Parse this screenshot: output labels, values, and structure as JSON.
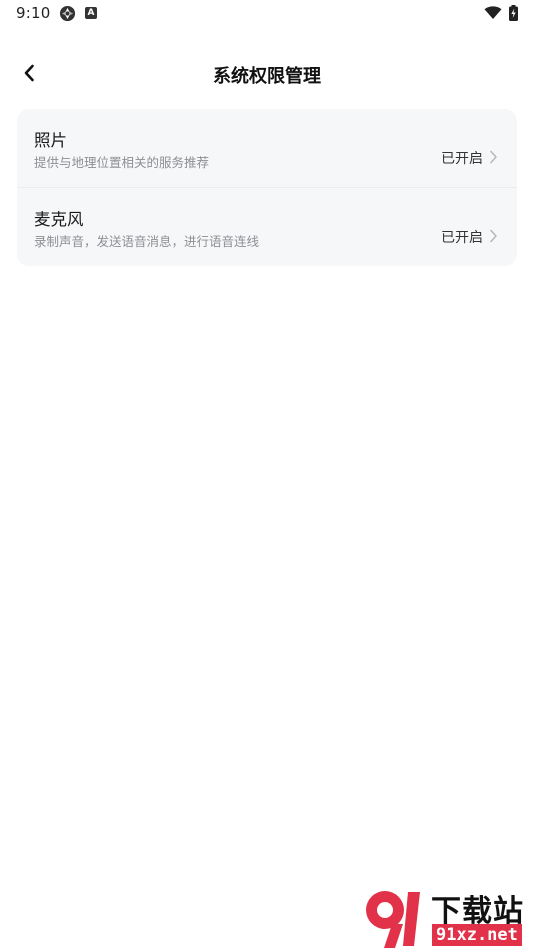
{
  "status_bar": {
    "time": "9:10",
    "icons": [
      "aperture-icon",
      "a-badge-icon",
      "wifi-icon",
      "battery-charging-icon"
    ],
    "badge_letter": "A"
  },
  "header": {
    "title": "系统权限管理",
    "back_icon": "chevron-left-icon"
  },
  "permissions": [
    {
      "title": "照片",
      "description": "提供与地理位置相关的服务推荐",
      "status": "已开启",
      "icon": "chevron-right-icon"
    },
    {
      "title": "麦克风",
      "description": "录制声音，发送语音消息，进行语音连线",
      "status": "已开启",
      "icon": "chevron-right-icon"
    }
  ],
  "watermark": {
    "text_cn": "下载站",
    "text_en": "91xz.net",
    "brand_color": "#e1324a"
  },
  "colors": {
    "card_bg": "#f6f7f9",
    "secondary_text": "#8d8f93"
  }
}
